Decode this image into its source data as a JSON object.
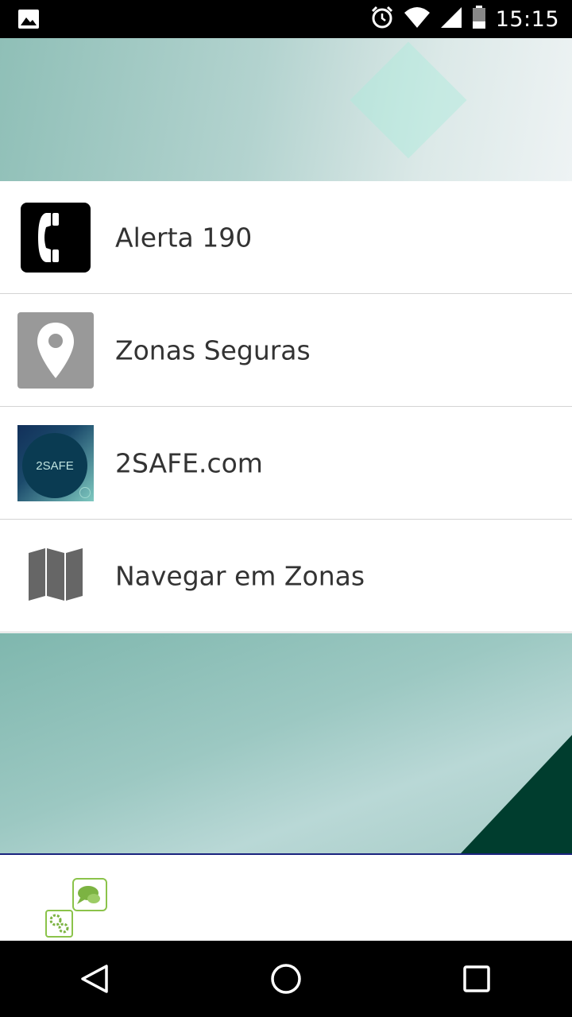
{
  "status_bar": {
    "time": "15:15",
    "icons": [
      "gallery-icon",
      "alarm-icon",
      "wifi-icon",
      "signal-icon",
      "battery-icon"
    ]
  },
  "menu": {
    "items": [
      {
        "label": "Alerta 190",
        "icon": "phone-icon"
      },
      {
        "label": "Zonas Seguras",
        "icon": "location-pin-icon"
      },
      {
        "label": "2SAFE.com",
        "icon": "2safe-logo-icon",
        "icon_text": "2SAFE"
      },
      {
        "label": "Navegar em Zonas",
        "icon": "map-icon"
      }
    ]
  },
  "nav_bar": {
    "buttons": [
      "back-icon",
      "home-icon",
      "recents-icon"
    ]
  },
  "colors": {
    "accent": "#7fb7ae",
    "footer_border": "#1a237e",
    "dark_corner": "#003d2e"
  }
}
